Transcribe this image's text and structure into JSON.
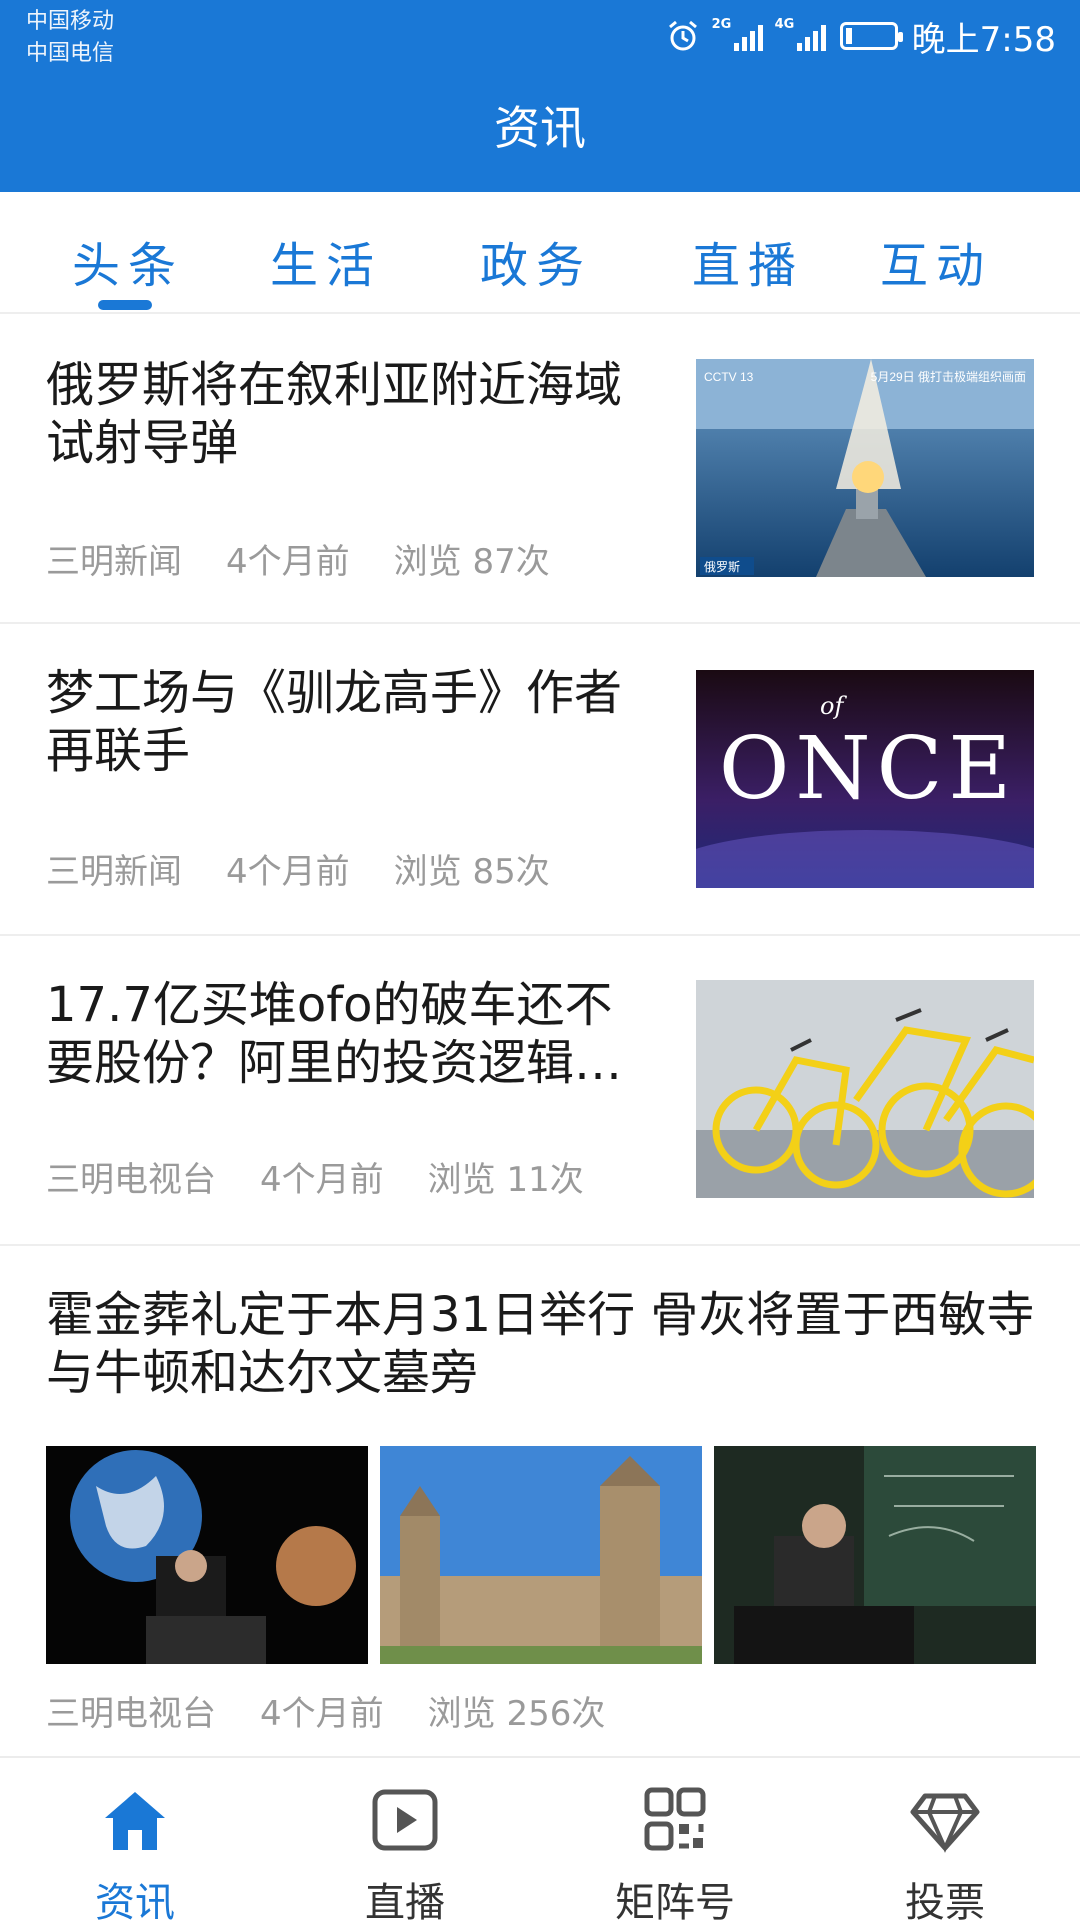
{
  "status_bar": {
    "carrier_1": "中国移动",
    "carrier_2": "中国电信",
    "network_1": "2G",
    "network_2": "4G",
    "time": "晚上7:58",
    "icons": [
      "alarm-icon",
      "signal-icon",
      "battery-icon"
    ]
  },
  "header": {
    "title": "资讯"
  },
  "tabs": [
    {
      "label": "头条",
      "active": true
    },
    {
      "label": "生活",
      "active": false
    },
    {
      "label": "政务",
      "active": false
    },
    {
      "label": "直播",
      "active": false
    },
    {
      "label": "互动",
      "active": false
    }
  ],
  "news": [
    {
      "title": "俄罗斯将在叙利亚附近海域试射导弹",
      "source": "三明新闻",
      "time": "4个月前",
      "views": "浏览 87次",
      "image": {
        "overlay_left": "CCTV 13",
        "overlay_right": "5月29日 俄打击极端组织画面",
        "overlay_bottom": "俄罗斯"
      }
    },
    {
      "title": "梦工场与《驯龙高手》作者再联手",
      "source": "三明新闻",
      "time": "4个月前",
      "views": "浏览 85次",
      "image": {
        "text": "ONCE",
        "small_text": "of"
      }
    },
    {
      "title": "17.7亿买堆ofo的破车还不要股份？阿里的投资逻辑…",
      "source": "三明电视台",
      "time": "4个月前",
      "views": "浏览 11次"
    },
    {
      "title": "霍金葬礼定于本月31日举行 骨灰将置于西敏寺与牛顿和达尔文墓旁",
      "source": "三明电视台",
      "time": "4个月前",
      "views": "浏览 256次"
    }
  ],
  "bottom_nav": [
    {
      "label": "资讯",
      "icon": "home-icon",
      "active": true
    },
    {
      "label": "直播",
      "icon": "play-icon",
      "active": false
    },
    {
      "label": "矩阵号",
      "icon": "grid-icon",
      "active": false
    },
    {
      "label": "投票",
      "icon": "diamond-icon",
      "active": false
    }
  ],
  "colors": {
    "primary": "#1a78d6",
    "meta_text": "#9a9a9a",
    "divider": "#eeeeee"
  }
}
